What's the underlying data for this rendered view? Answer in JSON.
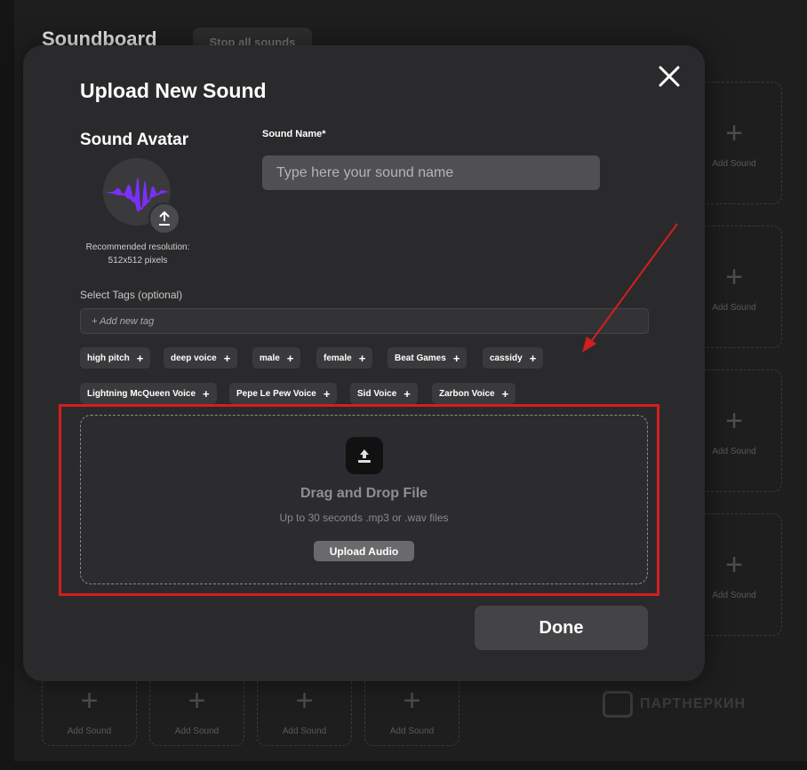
{
  "background": {
    "title": "Soundboard",
    "stop_all_label": "Stop all sounds",
    "add_sound_label": "Add Sound",
    "watermark_text": "ПАРТНЕРКИН"
  },
  "modal": {
    "title": "Upload New Sound",
    "avatar": {
      "heading": "Sound Avatar",
      "note_line1": "Recommended resolution:",
      "note_line2": "512x512 pixels",
      "icon": "upload-icon",
      "wave_color": "#7b2ff7"
    },
    "sound_name": {
      "label": "Sound Name*",
      "placeholder": "Type here your sound name",
      "value": ""
    },
    "tags": {
      "label": "Select Tags (optional)",
      "placeholder": "+ Add new tag",
      "items": [
        "high pitch",
        "deep voice",
        "male",
        "female",
        "Beat Games",
        "cassidy",
        "Lightning McQueen Voice",
        "Pepe Le Pew Voice",
        "Sid Voice",
        "Zarbon Voice"
      ]
    },
    "dropzone": {
      "title": "Drag and Drop File",
      "subtitle": "Up to 30 seconds .mp3 or .wav files",
      "button_label": "Upload Audio",
      "icon": "upload-tray-icon"
    },
    "done_label": "Done",
    "close_icon": "close-icon"
  },
  "annotation": {
    "highlight_color": "#d51e1e"
  }
}
